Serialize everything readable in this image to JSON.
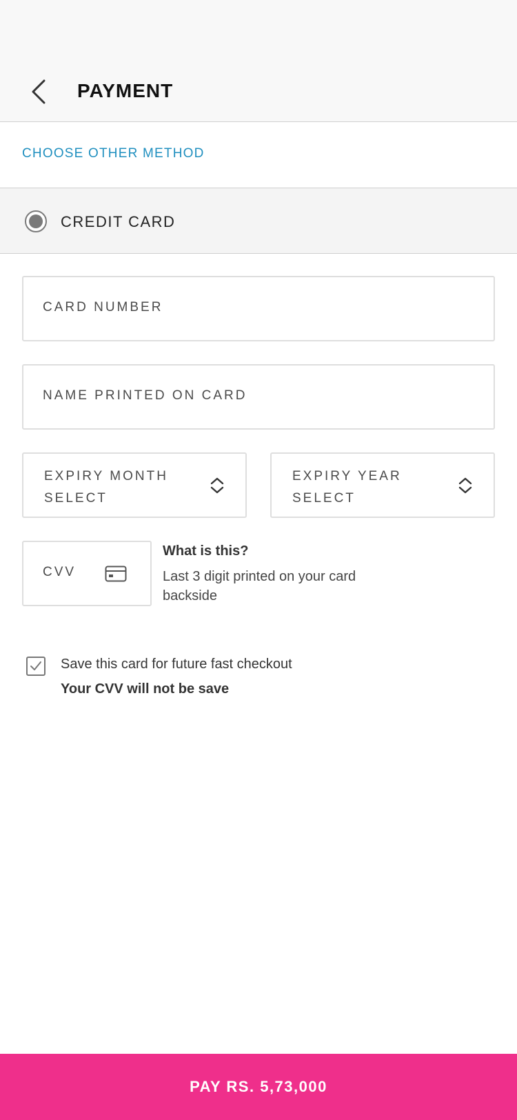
{
  "header": {
    "title": "PAYMENT",
    "back_icon": "chevron-left-icon"
  },
  "other_method_label": "CHOOSE OTHER METHOD",
  "method": {
    "label": "CREDIT CARD",
    "selected": true
  },
  "form": {
    "card_number_placeholder": "CARD NUMBER",
    "card_name_placeholder": "NAME PRINTED ON CARD",
    "expiry_month": {
      "label": "EXPIRY MONTH",
      "value": "SELECT"
    },
    "expiry_year": {
      "label": "EXPIRY YEAR",
      "value": "SELECT"
    },
    "cvv_placeholder": "CVV"
  },
  "cvv_help": {
    "title": "What is this?",
    "description": "Last 3 digit printed on your card backside"
  },
  "save_card": {
    "label": "Save this card for future fast checkout",
    "note": "Your CVV will not be save",
    "checked": true
  },
  "pay_button_label": "PAY RS. 5,73,000",
  "colors": {
    "accent": "#ef2f8b",
    "link": "#1f8fbf"
  }
}
